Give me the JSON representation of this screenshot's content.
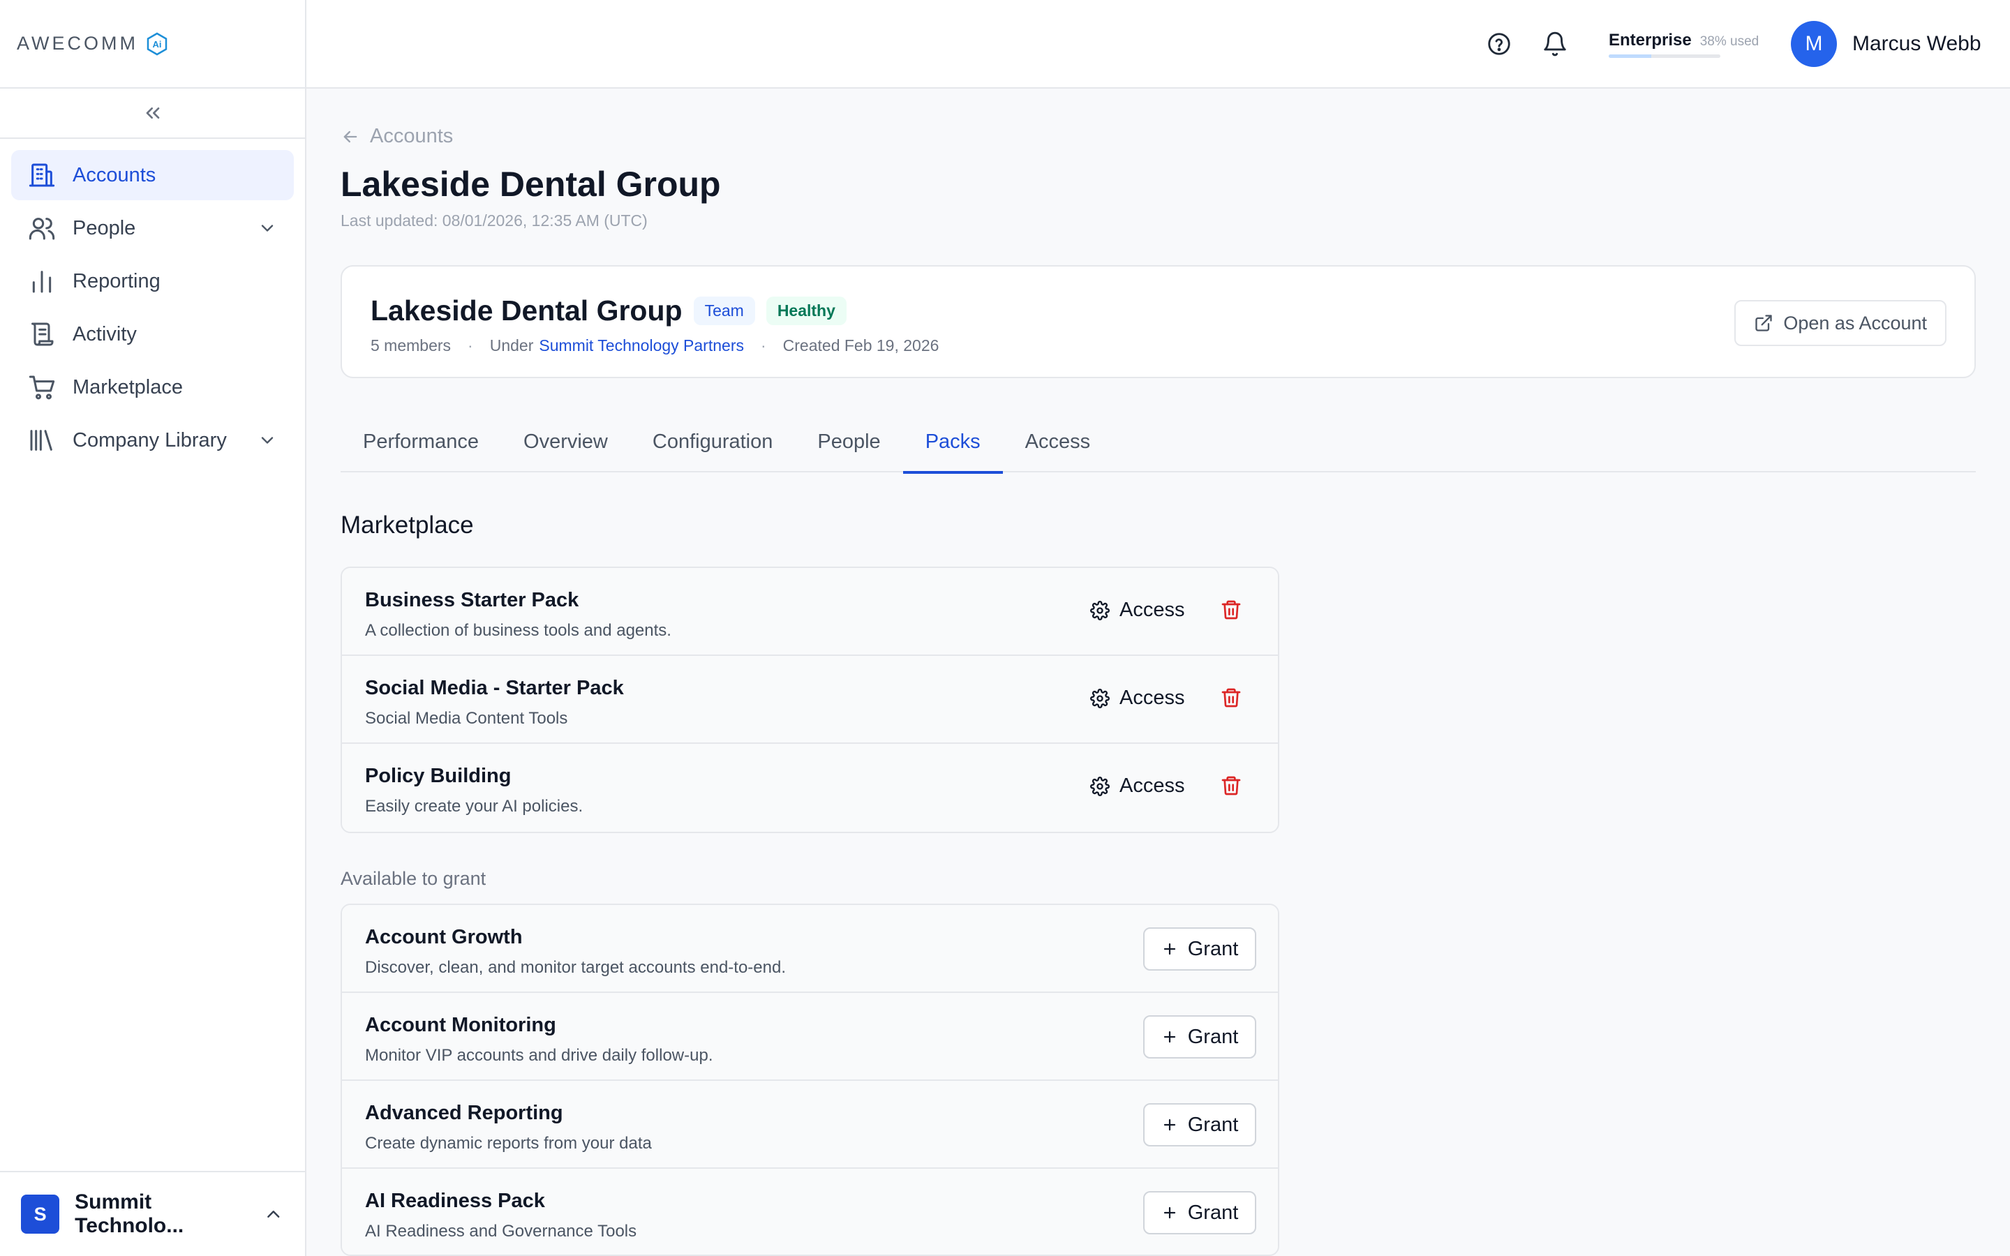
{
  "brand": {
    "logo_text": "AWECOMM",
    "logo_badge": "Ai"
  },
  "sidebar": {
    "items": [
      {
        "label": "Accounts",
        "icon": "building-icon",
        "active": true
      },
      {
        "label": "People",
        "icon": "users-icon",
        "expandable": true
      },
      {
        "label": "Reporting",
        "icon": "bar-chart-icon"
      },
      {
        "label": "Activity",
        "icon": "scroll-icon"
      },
      {
        "label": "Marketplace",
        "icon": "cart-icon"
      },
      {
        "label": "Company Library",
        "icon": "library-icon",
        "expandable": true
      }
    ],
    "org": {
      "initial": "S",
      "name": "Summit Technolo..."
    }
  },
  "topbar": {
    "plan_name": "Enterprise",
    "plan_usage": "38% used",
    "plan_usage_fraction": 0.38,
    "user_initial": "M",
    "user_name": "Marcus Webb"
  },
  "page": {
    "breadcrumb": "Accounts",
    "title": "Lakeside Dental Group",
    "last_updated": "Last updated: 08/01/2026, 12:35 AM (UTC)"
  },
  "summary": {
    "name": "Lakeside Dental Group",
    "badge_team": "Team",
    "badge_health": "Healthy",
    "members": "5 members",
    "under_label": "Under",
    "under_link": "Summit Technology Partners",
    "created": "Created Feb 19, 2026",
    "open_button": "Open as Account"
  },
  "tabs": [
    "Performance",
    "Overview",
    "Configuration",
    "People",
    "Packs",
    "Access"
  ],
  "active_tab": "Packs",
  "marketplace": {
    "title": "Marketplace",
    "access_label": "Access",
    "granted": [
      {
        "title": "Business Starter Pack",
        "desc": "A collection of business tools and agents."
      },
      {
        "title": "Social Media - Starter Pack",
        "desc": "Social Media Content Tools"
      },
      {
        "title": "Policy Building",
        "desc": "Easily create your AI policies."
      }
    ],
    "available_title": "Available to grant",
    "grant_label": "Grant",
    "available": [
      {
        "title": "Account Growth",
        "desc": "Discover, clean, and monitor target accounts end-to-end."
      },
      {
        "title": "Account Monitoring",
        "desc": "Monitor VIP accounts and drive daily follow-up."
      },
      {
        "title": "Advanced Reporting",
        "desc": "Create dynamic reports from your data"
      },
      {
        "title": "AI Readiness Pack",
        "desc": "AI Readiness and Governance Tools"
      }
    ]
  },
  "colors": {
    "accent": "#1d4ed8",
    "danger": "#dc2626",
    "success": "#047857"
  }
}
